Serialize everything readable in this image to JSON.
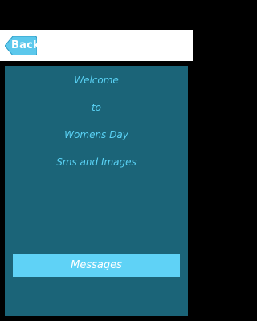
{
  "header": {
    "back_label": "Back"
  },
  "welcome": {
    "lines": [
      "Welcome",
      "to",
      "Womens Day",
      "Sms and Images"
    ]
  },
  "actions": {
    "messages_label": "Messages"
  },
  "colors": {
    "panel": "#1b6478",
    "accent_text": "#5ad2f5",
    "button": "#5fd2f6",
    "back_button": "#5cc8ec"
  },
  "icons": {
    "back": "arrow-left-icon"
  }
}
